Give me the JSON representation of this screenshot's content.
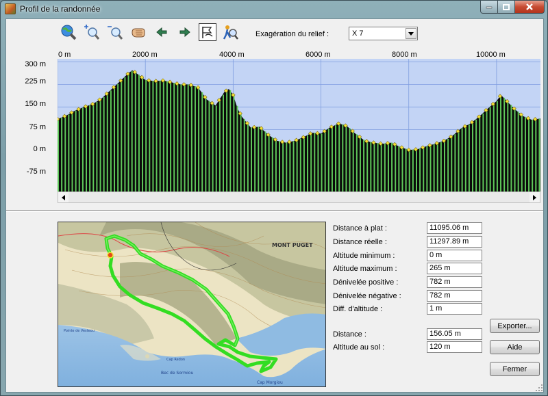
{
  "window": {
    "title": "Profil de la randonnée"
  },
  "toolbar": {
    "relief_label": "Exagération du relief :",
    "relief_value": "X 7",
    "buttons": [
      "zoom-globe",
      "zoom-in",
      "zoom-out",
      "pan-hand",
      "arrow-left",
      "arrow-right",
      "route-flag",
      "hiker-search"
    ]
  },
  "colors": {
    "sky": "#c3d4f5",
    "grid": "#7f9de0",
    "terrain": "#0a0a0a",
    "bars": "#5fc75a",
    "markers": "#f5e13a",
    "track": "#33dd22"
  },
  "chart_data": {
    "type": "area",
    "xlabel": "",
    "ylabel": "",
    "x_ticks": [
      "0 m",
      "2000 m",
      "4000 m",
      "6000 m",
      "8000 m",
      "10000 m"
    ],
    "y_ticks": [
      "300 m",
      "225 m",
      "150 m",
      "75 m",
      "0 m",
      "-75 m"
    ],
    "xlim": [
      0,
      11000
    ],
    "ylim": [
      -130,
      310
    ],
    "grid": true,
    "series": [
      {
        "x": [
          0,
          200,
          400,
          600,
          800,
          1000,
          1200,
          1400,
          1600,
          1700,
          1800,
          2000,
          2200,
          2400,
          2600,
          2800,
          3000,
          3200,
          3400,
          3600,
          3800,
          3900,
          4000,
          4100,
          4200,
          4400,
          4600,
          4800,
          5000,
          5200,
          5400,
          5600,
          5800,
          6000,
          6200,
          6400,
          6500,
          6600,
          6800,
          7000,
          7200,
          7400,
          7600,
          7800,
          8000,
          8200,
          8400,
          8600,
          8800,
          9000,
          9200,
          9400,
          9600,
          9800,
          10000,
          10100,
          10200,
          10400,
          10600,
          10800,
          11000
        ],
        "y": [
          110,
          122,
          138,
          150,
          160,
          178,
          205,
          232,
          260,
          272,
          262,
          240,
          236,
          238,
          232,
          225,
          225,
          215,
          175,
          155,
          200,
          210,
          190,
          145,
          118,
          82,
          85,
          58,
          38,
          32,
          38,
          50,
          65,
          62,
          82,
          95,
          92,
          86,
          60,
          38,
          32,
          28,
          32,
          18,
          8,
          10,
          20,
          28,
          38,
          55,
          80,
          95,
          118,
          145,
          170,
          190,
          175,
          145,
          120,
          108,
          112
        ]
      }
    ],
    "bar_x": [
      0,
      80,
      160,
      240,
      320,
      400,
      480,
      560,
      640,
      720,
      800,
      880,
      960,
      1040,
      1120,
      1200,
      1280,
      1360,
      1440,
      1520,
      1600,
      1680,
      1760,
      1840,
      1920,
      2000,
      2080,
      2160,
      2240,
      2320,
      2400,
      2480,
      2560,
      2640,
      2720,
      2800,
      2880,
      2960,
      3040,
      3120,
      3200,
      3280,
      3360,
      3440,
      3520,
      3600,
      3680,
      3760,
      3840,
      3920,
      4000,
      4080,
      4160,
      4240,
      4320,
      4400,
      4480,
      4560,
      4640,
      4720,
      4800,
      4880,
      4960,
      5040,
      5120,
      5200,
      5280,
      5360,
      5440,
      5520,
      5600,
      5680,
      5760,
      5840,
      5920,
      6000,
      6080,
      6160,
      6240,
      6320,
      6400,
      6480,
      6560,
      6640,
      6720,
      6800,
      6880,
      6960,
      7040,
      7120,
      7200,
      7280,
      7360,
      7440,
      7520,
      7600,
      7680,
      7760,
      7840,
      7920,
      8000,
      8080,
      8160,
      8240,
      8320,
      8400,
      8480,
      8560,
      8640,
      8720,
      8800,
      8880,
      8960,
      9040,
      9120,
      9200,
      9280,
      9360,
      9440,
      9520,
      9600,
      9680,
      9760,
      9840,
      9920,
      10000,
      10080,
      10160,
      10240,
      10320,
      10400,
      10480,
      10560,
      10640,
      10720,
      10800,
      10880,
      10960
    ]
  },
  "stats": [
    {
      "label": "Distance à plat :",
      "value": "11095.06 m"
    },
    {
      "label": "Distance réelle :",
      "value": "11297.89 m"
    },
    {
      "label": "Altitude minimum :",
      "value": "0 m"
    },
    {
      "label": "Altitude maximum :",
      "value": "265 m"
    },
    {
      "label": "Dénivelée positive :",
      "value": "782 m"
    },
    {
      "label": "Dénivelée négative :",
      "value": "782 m"
    },
    {
      "label": "Diff. d'altitude :",
      "value": "1 m"
    }
  ],
  "cursor": [
    {
      "label": "Distance :",
      "value": "156.05 m"
    },
    {
      "label": "Altitude au sol :",
      "value": "120 m"
    }
  ],
  "buttons": {
    "export": "Exporter...",
    "help": "Aide",
    "close": "Fermer"
  },
  "map": {
    "labels": [
      "MONT PUGET",
      "Cap Morgiou",
      "Bec de Sormiou",
      "Cap Redon",
      "Pointe de Vesteou"
    ]
  }
}
